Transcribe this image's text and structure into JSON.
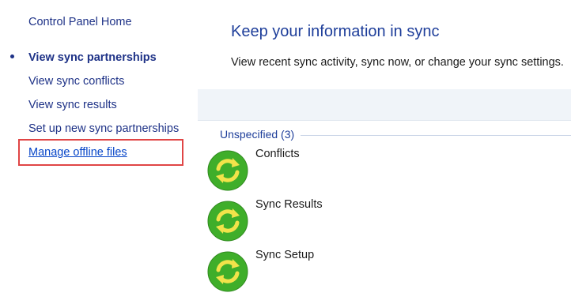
{
  "nav": {
    "home": "Control Panel Home",
    "items": [
      {
        "label": "View sync partnerships",
        "current": true
      },
      {
        "label": "View sync conflicts"
      },
      {
        "label": "View sync results"
      },
      {
        "label": "Set up new sync partnerships"
      },
      {
        "label": "Manage offline files",
        "highlighted": true
      }
    ]
  },
  "main": {
    "title": "Keep your information in sync",
    "description": "View recent sync activity, sync now, or change your sync settings.",
    "group": {
      "label": "Unspecified (3)",
      "items": [
        {
          "label": "Conflicts",
          "icon": "sync-arrows-icon"
        },
        {
          "label": "Sync Results",
          "icon": "sync-arrows-icon"
        },
        {
          "label": "Sync Setup",
          "icon": "sync-arrows-icon"
        }
      ]
    }
  },
  "colors": {
    "link": "#1e3287",
    "accent_link": "#0645c8",
    "highlight_border": "#e04545",
    "icon_green": "#3fae2a",
    "icon_arrow": "#f2e34a"
  }
}
